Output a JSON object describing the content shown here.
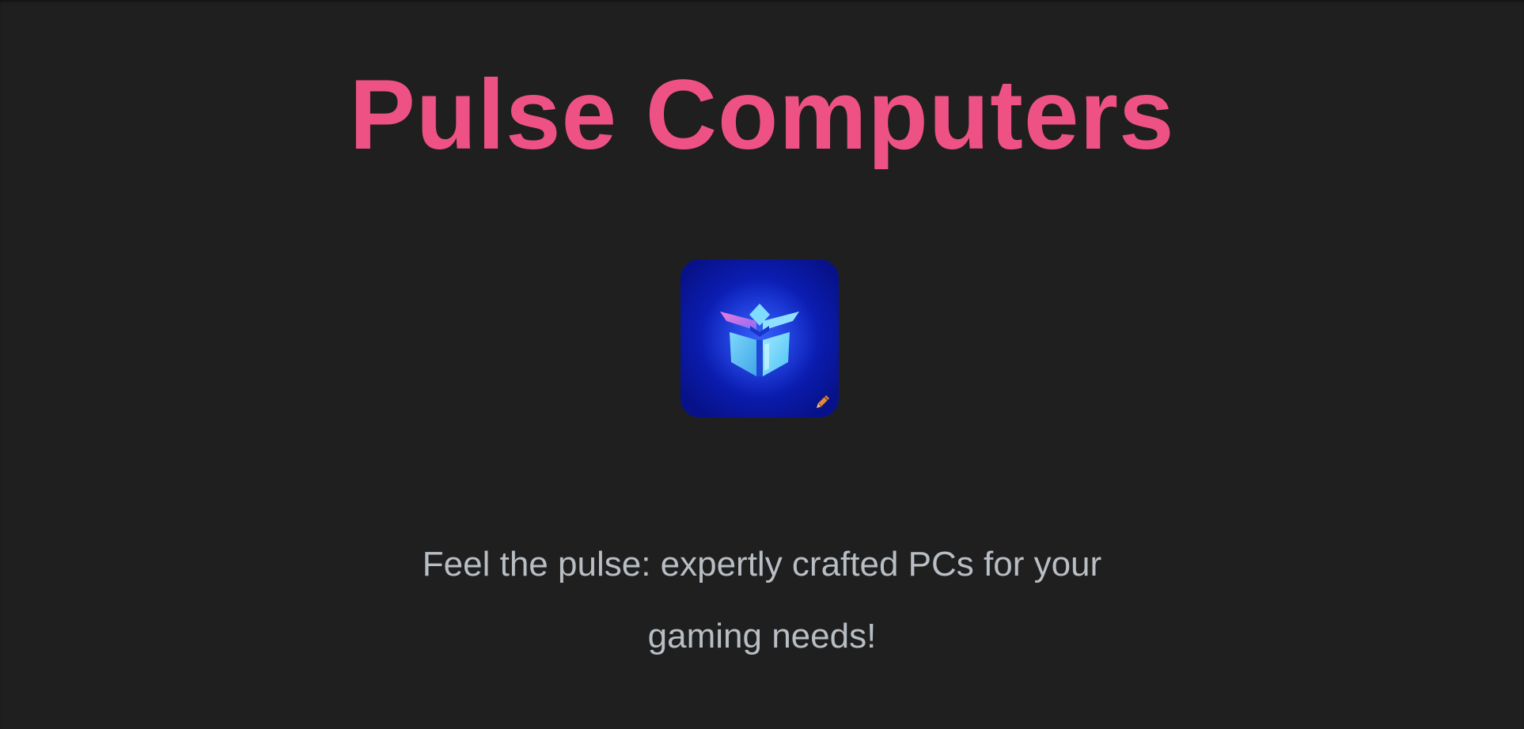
{
  "header": {
    "title": "Pulse Computers"
  },
  "logo": {
    "icon": "cube-logo-icon",
    "badge_icon": "pencil-edit-icon"
  },
  "main": {
    "tagline": "Feel the pulse: expertly crafted PCs for your gaming needs!"
  },
  "colors": {
    "background": "#1f1f1f",
    "title": "#ee5285",
    "tagline": "#b8bec4",
    "logo_bg": "#0a1aa8"
  }
}
